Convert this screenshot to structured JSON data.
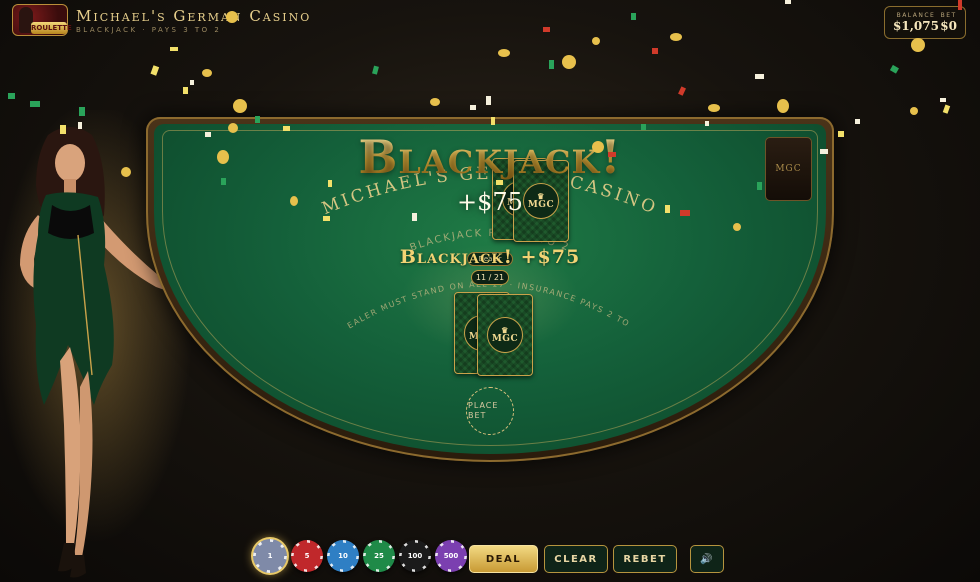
{
  "header": {
    "logo_text": "ROULETTE",
    "title": "Michael's German Casino",
    "subtitle": "BLACKJACK · PAYS 3 TO 2"
  },
  "hud": {
    "balance_label": "BALANCE",
    "balance_value": "$1,075",
    "bet_label": "BET",
    "bet_value": "$0"
  },
  "table": {
    "arc_title": "MICHAEL'S GERMAN CASINO",
    "arc_blackjack": "BLACKJACK PAYS 3 TO 2",
    "arc_rules": "DEALER MUST STAND ON ALL 17 · INSURANCE PAYS 2 TO 1",
    "shoe_label": "MGC",
    "card_brand": "MGC",
    "dealer_badge": "Dealer",
    "hand_count": "11 / 21",
    "place_bet": "PLACE BET"
  },
  "result": {
    "headline": "Blackjack!",
    "amount": "+$75",
    "line": "Blackjack! +$75"
  },
  "chips": [
    {
      "value": "1",
      "color": "#7f8aa8",
      "selected": true
    },
    {
      "value": "5",
      "color": "#c0282b",
      "selected": false
    },
    {
      "value": "10",
      "color": "#2f7fc4",
      "selected": false
    },
    {
      "value": "25",
      "color": "#1f8a48",
      "selected": false
    },
    {
      "value": "100",
      "color": "#1b1b1b",
      "selected": false
    },
    {
      "value": "500",
      "color": "#7b3fb0",
      "selected": false
    }
  ],
  "controls": {
    "deal": "DEAL",
    "clear": "CLEAR",
    "rebet": "REBET",
    "sound_icon": "speaker-icon"
  },
  "colors": {
    "felt": "#14603a",
    "gold": "#d8a93a",
    "background": "#17130e"
  }
}
